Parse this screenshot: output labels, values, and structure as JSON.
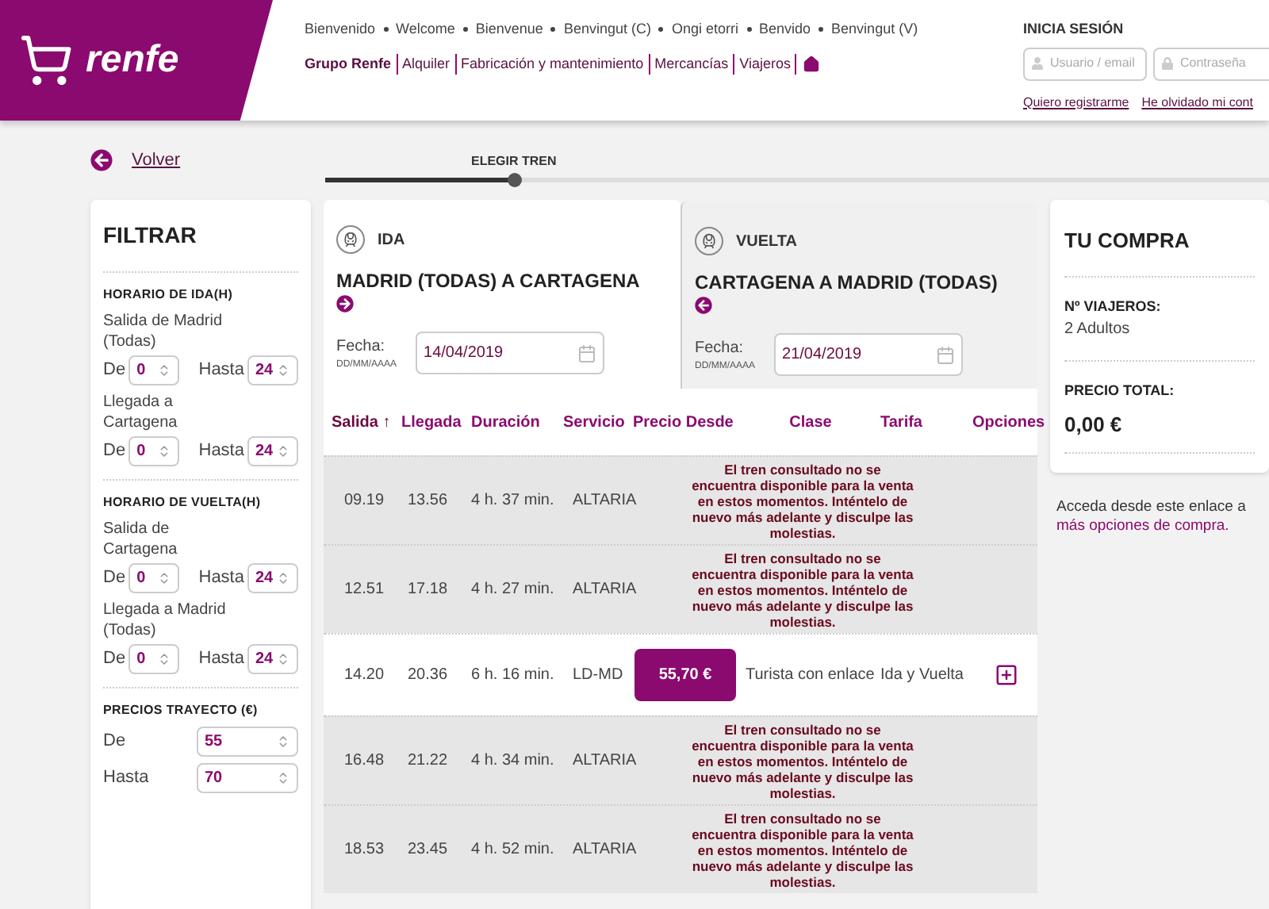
{
  "header": {
    "logo_text": "renfe",
    "languages": [
      "Bienvenido",
      "Welcome",
      "Bienvenue",
      "Benvingut (C)",
      "Ongi etorri",
      "Benvido",
      "Benvingut (V)"
    ],
    "nav": [
      "Grupo Renfe",
      "Alquiler",
      "Fabricación y mantenimiento",
      "Mercancías",
      "Viajeros"
    ],
    "login": {
      "title": "INICIA SESIÓN",
      "username_placeholder": "Usuario / email",
      "password_placeholder": "Contraseña",
      "links": [
        "Quiero registrarme",
        "He olvidado mi cont"
      ]
    }
  },
  "back": "Volver",
  "progress": {
    "label": "ELEGIR TREN",
    "level": 0.2
  },
  "filter": {
    "title": "FILTRAR",
    "sections": [
      {
        "title": "HORARIO DE IDA(H)",
        "kind": "range-hours",
        "groups": [
          {
            "label": "Salida de Madrid (Todas)",
            "from_label": "De",
            "from": "0",
            "to_label": "Hasta",
            "to": "24"
          },
          {
            "label": "Llegada a Cartagena",
            "from_label": "De",
            "from": "0",
            "to_label": "Hasta",
            "to": "24"
          }
        ]
      },
      {
        "title": "HORARIO DE VUELTA(H)",
        "kind": "range-hours",
        "groups": [
          {
            "label": "Salida de Cartagena",
            "from_label": "De",
            "from": "0",
            "to_label": "Hasta",
            "to": "24"
          },
          {
            "label": "Llegada a Madrid (Todas)",
            "from_label": "De",
            "from": "0",
            "to_label": "Hasta",
            "to": "24"
          }
        ]
      },
      {
        "title": "PRECIOS TRAYECTO (€)",
        "kind": "price",
        "groups": [
          {
            "from_label": "De",
            "from": "55",
            "to_label": "Hasta",
            "to": "70"
          }
        ]
      }
    ]
  },
  "tabs": [
    {
      "label": "IDA",
      "route": "MADRID (TODAS) A CARTAGENA",
      "kind": "outbound",
      "date_label": "Fecha:",
      "date_hint": "DD/MM/AAAA",
      "date": "14/04/2019",
      "selected": true
    },
    {
      "label": "VUELTA",
      "route": "CARTAGENA A MADRID (TODAS)",
      "kind": "return",
      "date_label": "Fecha:",
      "date_hint": "DD/MM/AAAA",
      "date": "21/04/2019",
      "selected": false
    }
  ],
  "table": {
    "columns": [
      "Salida ↑",
      "Llegada",
      "Duración",
      "Servicio",
      "Precio Desde",
      "Clase",
      "Tarifa",
      "Opciones"
    ],
    "rows": [
      {
        "kind": "unavailable",
        "departure": "09.19",
        "arrival": "13.56",
        "duration": "4 h. 37 min.",
        "service": "ALTARIA",
        "message": "El tren consultado no se encuentra disponible para la venta en estos momentos. Inténtelo de nuevo más adelante y disculpe las molestias."
      },
      {
        "kind": "unavailable",
        "departure": "12.51",
        "arrival": "17.18",
        "duration": "4 h. 27 min.",
        "service": "ALTARIA",
        "message": "El tren consultado no se encuentra disponible para la venta en estos momentos. Inténtelo de nuevo más adelante y disculpe las molestias."
      },
      {
        "kind": "available",
        "departure": "14.20",
        "arrival": "20.36",
        "duration": "6 h. 16 min.",
        "service": "LD-MD",
        "price": "55,70 €",
        "class": "Turista con enlace",
        "fare": "Ida y Vuelta"
      },
      {
        "kind": "unavailable",
        "departure": "16.48",
        "arrival": "21.22",
        "duration": "4 h. 34 min.",
        "service": "ALTARIA",
        "message": "El tren consultado no se encuentra disponible para la venta en estos momentos. Inténtelo de nuevo más adelante y disculpe las molestias."
      },
      {
        "kind": "unavailable",
        "departure": "18.53",
        "arrival": "23.45",
        "duration": "4 h. 52 min.",
        "service": "ALTARIA",
        "message": "El tren consultado no se encuentra disponible para la venta en estos momentos. Inténtelo de nuevo más adelante y disculpe las molestias."
      }
    ]
  },
  "summary": {
    "title": "TU COMPRA",
    "travellers_label": "Nº VIAJEROS:",
    "travellers": "2 Adultos",
    "total_label": "PRECIO TOTAL:",
    "total": "0,00 €",
    "note": "Acceda desde este enlace a",
    "note_link": "más opciones de compra."
  }
}
